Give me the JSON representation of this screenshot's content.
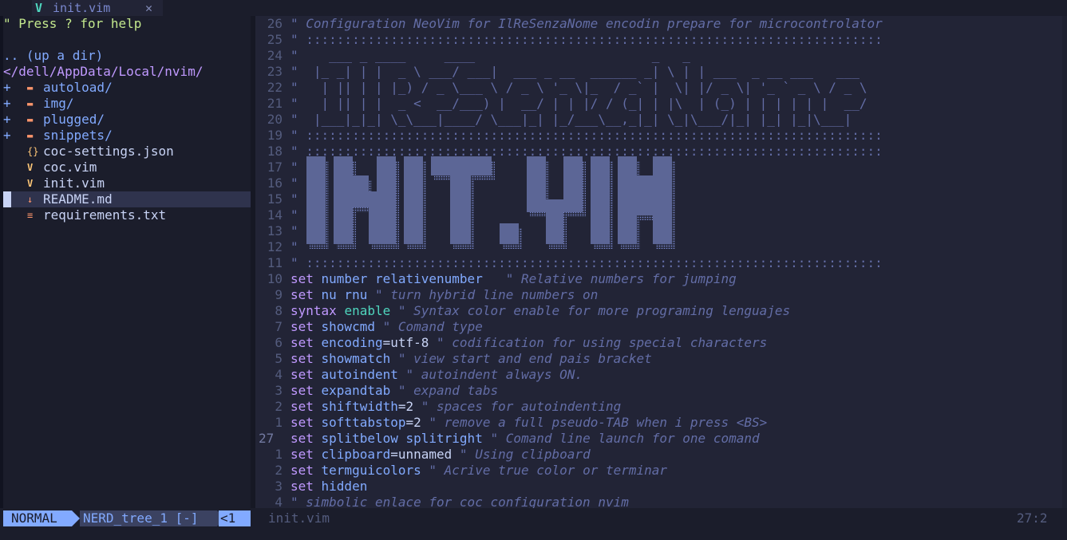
{
  "tab": {
    "icon": "vim-icon",
    "label": "init.vim",
    "close": "✕"
  },
  "tree": {
    "help": "\" Press ? for help",
    "up": ".. (up a dir)",
    "path": "</dell/AppData/Local/nvim/",
    "entries": [
      {
        "sign": "+",
        "icon": "folder-icon",
        "glyph": "▬",
        "name": "autoload/"
      },
      {
        "sign": "+",
        "icon": "folder-icon",
        "glyph": "▬",
        "name": "img/"
      },
      {
        "sign": "+",
        "icon": "folder-icon",
        "glyph": "▬",
        "name": "plugged/"
      },
      {
        "sign": "+",
        "icon": "folder-icon",
        "glyph": "▬",
        "name": "snippets/"
      },
      {
        "sign": "",
        "icon": "json-icon",
        "glyph": "{}",
        "name": "coc-settings.json"
      },
      {
        "sign": "",
        "icon": "vim-file-icon",
        "glyph": "V",
        "name": "coc.vim"
      },
      {
        "sign": "",
        "icon": "vim-file-icon",
        "glyph": "V",
        "name": "init.vim"
      },
      {
        "sign": "",
        "icon": "markdown-icon",
        "glyph": "↓",
        "name": "README.md"
      },
      {
        "sign": "",
        "icon": "text-file-icon",
        "glyph": "≡",
        "name": "requirements.txt"
      }
    ],
    "selected": "README.md"
  },
  "editor": {
    "lines": [
      {
        "n": "26",
        "parts": [
          {
            "c": "cmtp",
            "t": "\" "
          },
          {
            "c": "cmt",
            "t": "Configuration NeoVim for IlReSenzaNome encodin prepare for microcontrolator"
          }
        ]
      },
      {
        "n": "25",
        "parts": [
          {
            "c": "cmtp",
            "t": "\" :::::::::::::::::::::::::::::::::::::::::::::::::::::::::::::::::::::::::::"
          }
        ]
      },
      {
        "n": "24",
        "parts": [
          {
            "c": "cmtp",
            "t": "\"    ___ _ ____     ____                       _   _"
          }
        ]
      },
      {
        "n": "23",
        "parts": [
          {
            "c": "cmtp",
            "t": "\"  |_ _| | |  _ \\ ___/ ___|  ___ _ __  ______ _| \\ | | ___  _ __ ___   ___"
          }
        ]
      },
      {
        "n": "22",
        "parts": [
          {
            "c": "cmtp",
            "t": "\"   | || | | |_) / _ \\___ \\ / _ \\ '_ \\|_  / _` |  \\| |/ _ \\| '_ ` _ \\ / _ \\"
          }
        ]
      },
      {
        "n": "21",
        "parts": [
          {
            "c": "cmtp",
            "t": "\"   | || | |  _ <  __/___) |  __/ | | |/ / (_| | |\\  | (_) | | | | | |  __/"
          }
        ]
      },
      {
        "n": "20",
        "parts": [
          {
            "c": "cmtp",
            "t": "\"  |___|_|_| \\_\\___|____/ \\___|_| |_/___\\__,_|_| \\_|\\___/|_| |_| |_|\\___|"
          }
        ]
      },
      {
        "n": "19",
        "parts": [
          {
            "c": "cmtp",
            "t": "\" :::::::::::::::::::::::::::::::::::::::::::::::::::::::::::::::::::::::::::"
          }
        ]
      },
      {
        "n": "18",
        "parts": [
          {
            "c": "cmtp",
            "t": "\" :::::::::::::::::::::::::::::::::::::::::::::::::::::::::::::::::::::::::::"
          }
        ]
      },
      {
        "n": "17",
        "parts": [
          {
            "c": "cmtp",
            "t": "\""
          }
        ]
      },
      {
        "n": "16",
        "parts": [
          {
            "c": "cmtp",
            "t": "\""
          }
        ]
      },
      {
        "n": "15",
        "parts": [
          {
            "c": "cmtp",
            "t": "\""
          }
        ]
      },
      {
        "n": "14",
        "parts": [
          {
            "c": "cmtp",
            "t": "\""
          }
        ]
      },
      {
        "n": "13",
        "parts": [
          {
            "c": "cmtp",
            "t": "\""
          }
        ]
      },
      {
        "n": "12",
        "parts": [
          {
            "c": "cmtp",
            "t": "\""
          }
        ]
      },
      {
        "n": "11",
        "parts": [
          {
            "c": "cmtp",
            "t": "\" :::::::::::::::::::::::::::::::::::::::::::::::::::::::::::::::::::::::::::"
          }
        ]
      },
      {
        "n": "10",
        "parts": [
          {
            "c": "kw",
            "t": "set "
          },
          {
            "c": "opt",
            "t": "number relativenumber"
          },
          {
            "c": "cmtp",
            "t": "   \" "
          },
          {
            "c": "cmt",
            "t": "Relative numbers for jumping"
          }
        ]
      },
      {
        "n": "9",
        "parts": [
          {
            "c": "kw",
            "t": "set "
          },
          {
            "c": "opt",
            "t": "nu rnu"
          },
          {
            "c": "cmtp",
            "t": " \" "
          },
          {
            "c": "cmt",
            "t": "turn hybrid line numbers on"
          }
        ]
      },
      {
        "n": "8",
        "parts": [
          {
            "c": "kw",
            "t": "syntax "
          },
          {
            "c": "kw2",
            "t": "enable"
          },
          {
            "c": "cmtp",
            "t": " \" "
          },
          {
            "c": "cmt",
            "t": "Syntax color enable for more programing lenguajes"
          }
        ]
      },
      {
        "n": "7",
        "parts": [
          {
            "c": "kw",
            "t": "set "
          },
          {
            "c": "opt",
            "t": "showcmd"
          },
          {
            "c": "cmtp",
            "t": " \" "
          },
          {
            "c": "cmt",
            "t": "Comand type"
          }
        ]
      },
      {
        "n": "6",
        "parts": [
          {
            "c": "kw",
            "t": "set "
          },
          {
            "c": "opt",
            "t": "encoding"
          },
          {
            "c": "val",
            "t": "=utf-8"
          },
          {
            "c": "cmtp",
            "t": " \" "
          },
          {
            "c": "cmt",
            "t": "codification for using special characters"
          }
        ]
      },
      {
        "n": "5",
        "parts": [
          {
            "c": "kw",
            "t": "set "
          },
          {
            "c": "opt",
            "t": "showmatch"
          },
          {
            "c": "cmtp",
            "t": " \" "
          },
          {
            "c": "cmt",
            "t": "view start and end pais bracket"
          }
        ]
      },
      {
        "n": "4",
        "parts": [
          {
            "c": "kw",
            "t": "set "
          },
          {
            "c": "opt",
            "t": "autoindent"
          },
          {
            "c": "cmtp",
            "t": " \" "
          },
          {
            "c": "cmt",
            "t": "autoindent always ON."
          }
        ]
      },
      {
        "n": "3",
        "parts": [
          {
            "c": "kw",
            "t": "set "
          },
          {
            "c": "opt",
            "t": "expandtab"
          },
          {
            "c": "cmtp",
            "t": " \" "
          },
          {
            "c": "cmt",
            "t": "expand tabs"
          }
        ]
      },
      {
        "n": "2",
        "parts": [
          {
            "c": "kw",
            "t": "set "
          },
          {
            "c": "opt",
            "t": "shiftwidth"
          },
          {
            "c": "val",
            "t": "=2"
          },
          {
            "c": "cmtp",
            "t": " \" "
          },
          {
            "c": "cmt",
            "t": "spaces for autoindenting"
          }
        ]
      },
      {
        "n": "1",
        "parts": [
          {
            "c": "kw",
            "t": "set "
          },
          {
            "c": "opt",
            "t": "softtabstop"
          },
          {
            "c": "val",
            "t": "=2"
          },
          {
            "c": "cmtp",
            "t": " \" "
          },
          {
            "c": "cmt",
            "t": "remove a full pseudo-TAB when i press <BS>"
          }
        ]
      },
      {
        "n": "27",
        "cur": true,
        "parts": [
          {
            "c": "kw",
            "t": "set "
          },
          {
            "c": "opt",
            "t": "splitbelow splitright"
          },
          {
            "c": "cmtp",
            "t": " \" "
          },
          {
            "c": "cmt",
            "t": "Comand line launch for one comand"
          }
        ]
      },
      {
        "n": "1",
        "parts": [
          {
            "c": "kw",
            "t": "set "
          },
          {
            "c": "opt",
            "t": "clipboard"
          },
          {
            "c": "val",
            "t": "=unnamed"
          },
          {
            "c": "cmtp",
            "t": " \" "
          },
          {
            "c": "cmt",
            "t": "Using clipboard"
          }
        ]
      },
      {
        "n": "2",
        "parts": [
          {
            "c": "kw",
            "t": "set "
          },
          {
            "c": "opt",
            "t": "termguicolors"
          },
          {
            "c": "cmtp",
            "t": " \" "
          },
          {
            "c": "cmt",
            "t": "Acrive true color or terminar"
          }
        ]
      },
      {
        "n": "3",
        "parts": [
          {
            "c": "kw",
            "t": "set "
          },
          {
            "c": "opt",
            "t": "hidden"
          }
        ]
      },
      {
        "n": "4",
        "parts": [
          {
            "c": "cmtp",
            "t": "\" "
          },
          {
            "c": "cmt",
            "t": "simbolic enlace for coc configuration nvim"
          }
        ]
      }
    ],
    "big_art": "INIT.VIM"
  },
  "statusline": {
    "mode": "NORMAL",
    "buffer": "NERD_tree_1 [-]",
    "pos_left": "<1",
    "filename": "init.vim",
    "cursor": "27:2"
  },
  "colors": {
    "background": "#222436",
    "accent": "#82aaff",
    "keyword": "#c099ff",
    "comment": "#636da6"
  }
}
